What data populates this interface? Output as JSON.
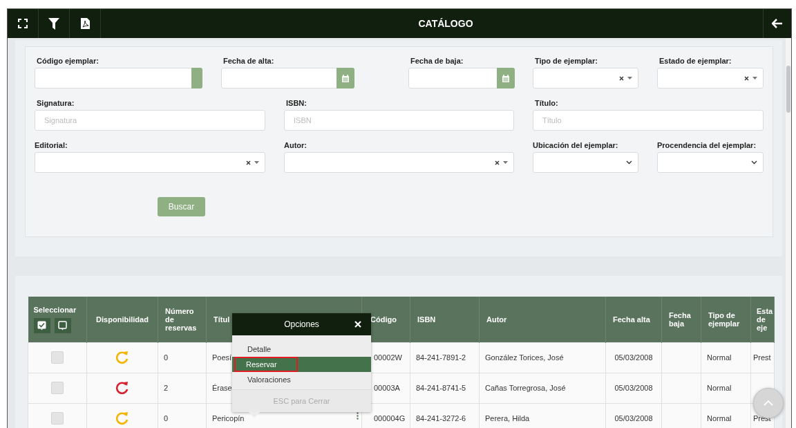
{
  "header": {
    "title": "CATÁLOGO"
  },
  "filters": {
    "fields": [
      {
        "label": "Código ejemplar:",
        "kind": "addon"
      },
      {
        "label": "Fecha de alta:",
        "kind": "date"
      },
      {
        "label": "Fecha de baja:",
        "kind": "date"
      },
      {
        "label": "Tipo de ejemplar:",
        "kind": "combo"
      },
      {
        "label": "Estado de ejemplar:",
        "kind": "combo"
      },
      {
        "label": "Signatura:",
        "kind": "text",
        "placeholder": "Signatura"
      },
      {
        "label": "ISBN:",
        "kind": "text",
        "placeholder": "ISBN"
      },
      {
        "label": "Título:",
        "kind": "text",
        "placeholder": "Título"
      },
      {
        "label": "Editorial:",
        "kind": "combo"
      },
      {
        "label": "Autor:",
        "kind": "combo"
      },
      {
        "label": "Ubicación del ejemplar:",
        "kind": "select"
      },
      {
        "label": "Procendencia del ejemplar:",
        "kind": "select"
      }
    ],
    "search_button": "Buscar"
  },
  "table": {
    "columns": [
      "Seleccionar",
      "Disponibilidad",
      "Número de reservas",
      "Títul",
      "Código",
      "ISBN",
      "Autor",
      "Fecha alta",
      "Fecha baja",
      "Tipo de ejemplar",
      "Esta de eje"
    ],
    "rows": [
      {
        "checked": false,
        "color": "#f5b400",
        "reservations": "0",
        "title": "Poesí",
        "code": "00002W",
        "isbn": "84-241-7891-2",
        "author": "González Torices, José",
        "fecha_alta": "05/03/2008",
        "tipo": "Normal",
        "estado": "Prest",
        "options_button": false
      },
      {
        "checked": false,
        "color": "#d8202f",
        "reservations": "2",
        "title": "Érase",
        "code": "00003A",
        "isbn": "84-241-8741-5",
        "author": "Cañas Torregrosa, José",
        "fecha_alta": "05/03/2008",
        "tipo": "Normal",
        "options_button": false
      },
      {
        "checked": false,
        "color": "#f5b400",
        "reservations": "0",
        "title": "Pericopín",
        "code": "000004G",
        "isbn": "84-241-3272-6",
        "author": "Perera, Hilda",
        "fecha_alta": "05/03/2008",
        "tipo": "Normal",
        "estado": "Prest",
        "options_button": true
      }
    ]
  },
  "popup": {
    "title": "Opciones",
    "items": [
      {
        "label": "Detalle",
        "selected": false
      },
      {
        "label": "Reservar",
        "selected": true
      },
      {
        "label": "Valoraciones",
        "selected": false
      }
    ],
    "footer": "ESC para Cerrar"
  }
}
